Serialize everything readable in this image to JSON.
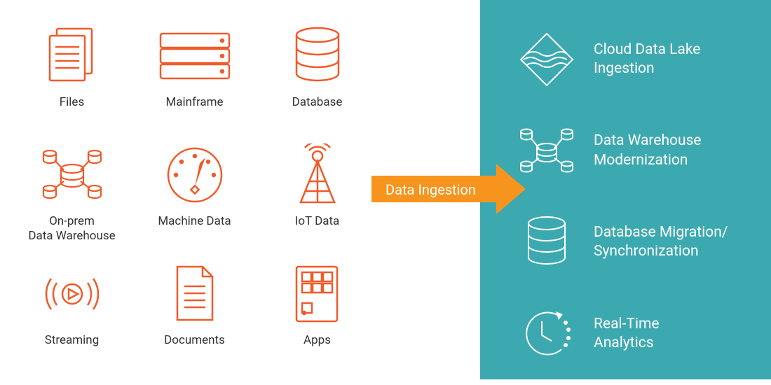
{
  "colors": {
    "orange": "#f15a29",
    "arrowOrange": "#f7941d",
    "teal": "#3ca9b0",
    "white": "#ffffff",
    "text": "#333333"
  },
  "arrow": {
    "label": "Data Ingestion"
  },
  "sources": [
    {
      "id": "files",
      "label": "Files",
      "icon": "files-icon"
    },
    {
      "id": "mainframe",
      "label": "Mainframe",
      "icon": "mainframe-icon"
    },
    {
      "id": "database",
      "label": "Database",
      "icon": "database-icon"
    },
    {
      "id": "onprem-dw",
      "label": "On-prem\nData Warehouse",
      "icon": "warehouse-icon"
    },
    {
      "id": "machine-data",
      "label": "Machine Data",
      "icon": "gauge-icon"
    },
    {
      "id": "iot-data",
      "label": "IoT Data",
      "icon": "antenna-icon"
    },
    {
      "id": "streaming",
      "label": "Streaming",
      "icon": "streaming-icon"
    },
    {
      "id": "documents",
      "label": "Documents",
      "icon": "document-icon"
    },
    {
      "id": "apps",
      "label": "Apps",
      "icon": "apps-icon"
    }
  ],
  "destinations": [
    {
      "id": "data-lake",
      "label": "Cloud Data Lake\nIngestion",
      "icon": "lake-icon"
    },
    {
      "id": "dw-modern",
      "label": "Data Warehouse\nModernization",
      "icon": "warehouse-white-icon"
    },
    {
      "id": "db-migration",
      "label": "Database Migration/\nSynchronization",
      "icon": "database-white-icon"
    },
    {
      "id": "realtime",
      "label": "Real-Time\nAnalytics",
      "icon": "clock-icon"
    }
  ]
}
